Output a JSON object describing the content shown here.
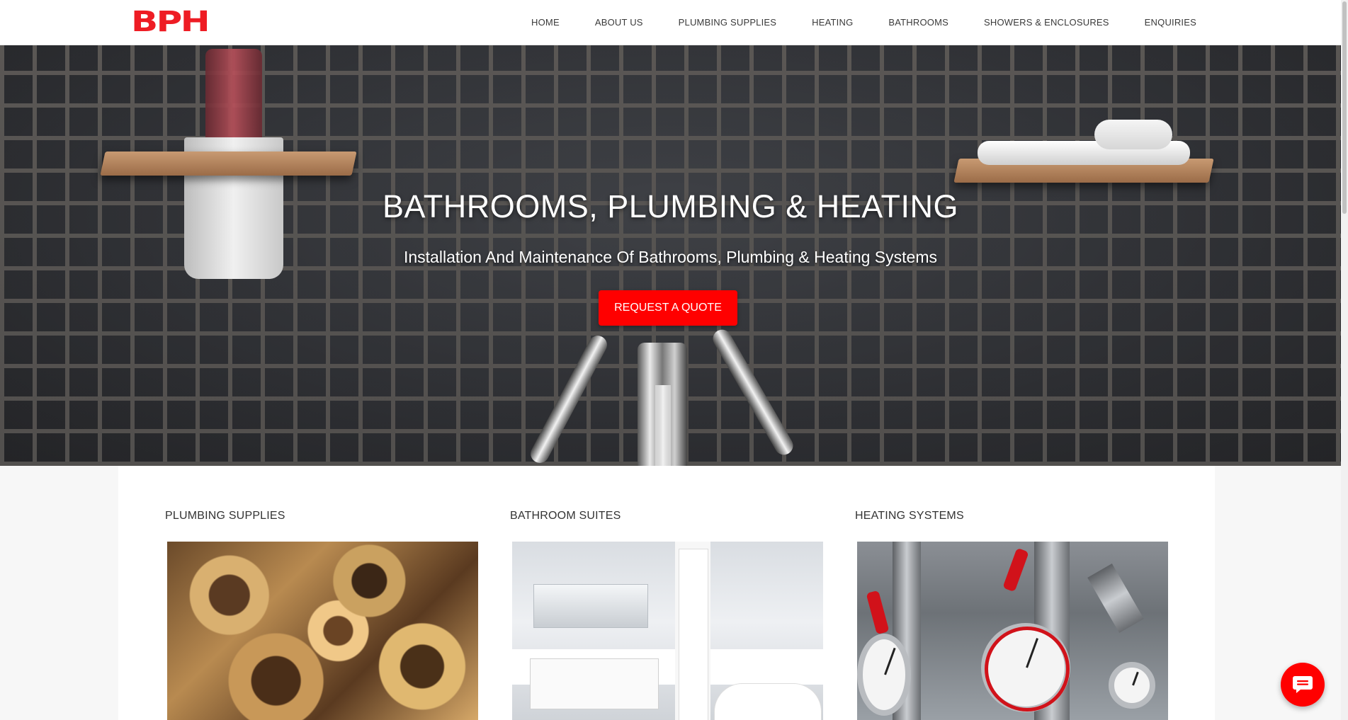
{
  "brand": {
    "logo_text": "BPH",
    "accent_color": "#ff0000"
  },
  "nav": {
    "items": [
      {
        "label": "HOME"
      },
      {
        "label": "ABOUT US"
      },
      {
        "label": "PLUMBING SUPPLIES"
      },
      {
        "label": "HEATING"
      },
      {
        "label": "BATHROOMS"
      },
      {
        "label": "SHOWERS & ENCLOSURES"
      },
      {
        "label": "ENQUIRIES"
      }
    ]
  },
  "hero": {
    "title": "BATHROOMS, PLUMBING & HEATING",
    "subtitle": "Installation And Maintenance Of Bathrooms, Plumbing & Heating Systems",
    "cta_label": "REQUEST A QUOTE"
  },
  "cards": [
    {
      "title": "PLUMBING SUPPLIES",
      "image": "copper-pipe-fittings"
    },
    {
      "title": "BATHROOM SUITES",
      "image": "modern-bathroom"
    },
    {
      "title": "HEATING SYSTEMS",
      "image": "heating-valves-gauges"
    }
  ],
  "chat": {
    "icon": "chat-bubble-icon"
  }
}
